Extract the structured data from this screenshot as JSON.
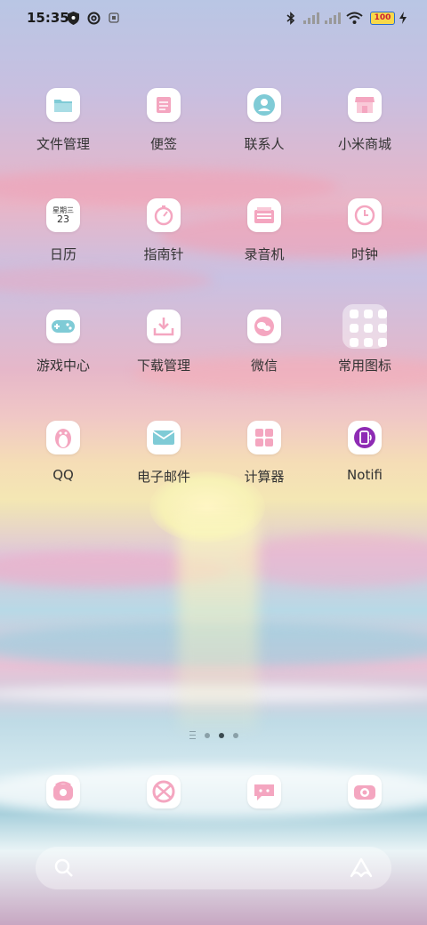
{
  "status_bar": {
    "time": "15:35",
    "battery_level": "100",
    "icons": [
      "shield-icon",
      "at-icon",
      "notification-icon",
      "bluetooth-icon",
      "signal-icon",
      "signal-icon",
      "wifi-icon",
      "battery-icon",
      "charging-icon"
    ]
  },
  "apps": [
    {
      "label": "文件管理",
      "icon": "folder-icon"
    },
    {
      "label": "便签",
      "icon": "notes-icon"
    },
    {
      "label": "联系人",
      "icon": "contacts-icon"
    },
    {
      "label": "小米商城",
      "icon": "store-icon"
    },
    {
      "label": "日历",
      "icon": "calendar-icon",
      "badge_top": "星期三",
      "badge_day": "23"
    },
    {
      "label": "指南针",
      "icon": "compass-icon"
    },
    {
      "label": "录音机",
      "icon": "recorder-icon"
    },
    {
      "label": "时钟",
      "icon": "clock-icon"
    },
    {
      "label": "游戏中心",
      "icon": "gamepad-icon"
    },
    {
      "label": "下载管理",
      "icon": "download-icon"
    },
    {
      "label": "微信",
      "icon": "wechat-icon"
    },
    {
      "label": "常用图标",
      "icon": "folder-grid-icon"
    },
    {
      "label": "QQ",
      "icon": "penguin-icon"
    },
    {
      "label": "电子邮件",
      "icon": "mail-icon"
    },
    {
      "label": "计算器",
      "icon": "calculator-icon"
    },
    {
      "label": "Notifi",
      "icon": "notifi-icon"
    }
  ],
  "dock": [
    {
      "icon": "phone-icon"
    },
    {
      "icon": "browser-icon"
    },
    {
      "icon": "messages-icon"
    },
    {
      "icon": "camera-icon"
    }
  ],
  "page_indicator": {
    "pages": 3,
    "active": 2
  },
  "colors": {
    "icon_pink": "#f4a6c0",
    "icon_teal": "#7fcbd6",
    "notifi_purple": "#8e2bb4"
  }
}
